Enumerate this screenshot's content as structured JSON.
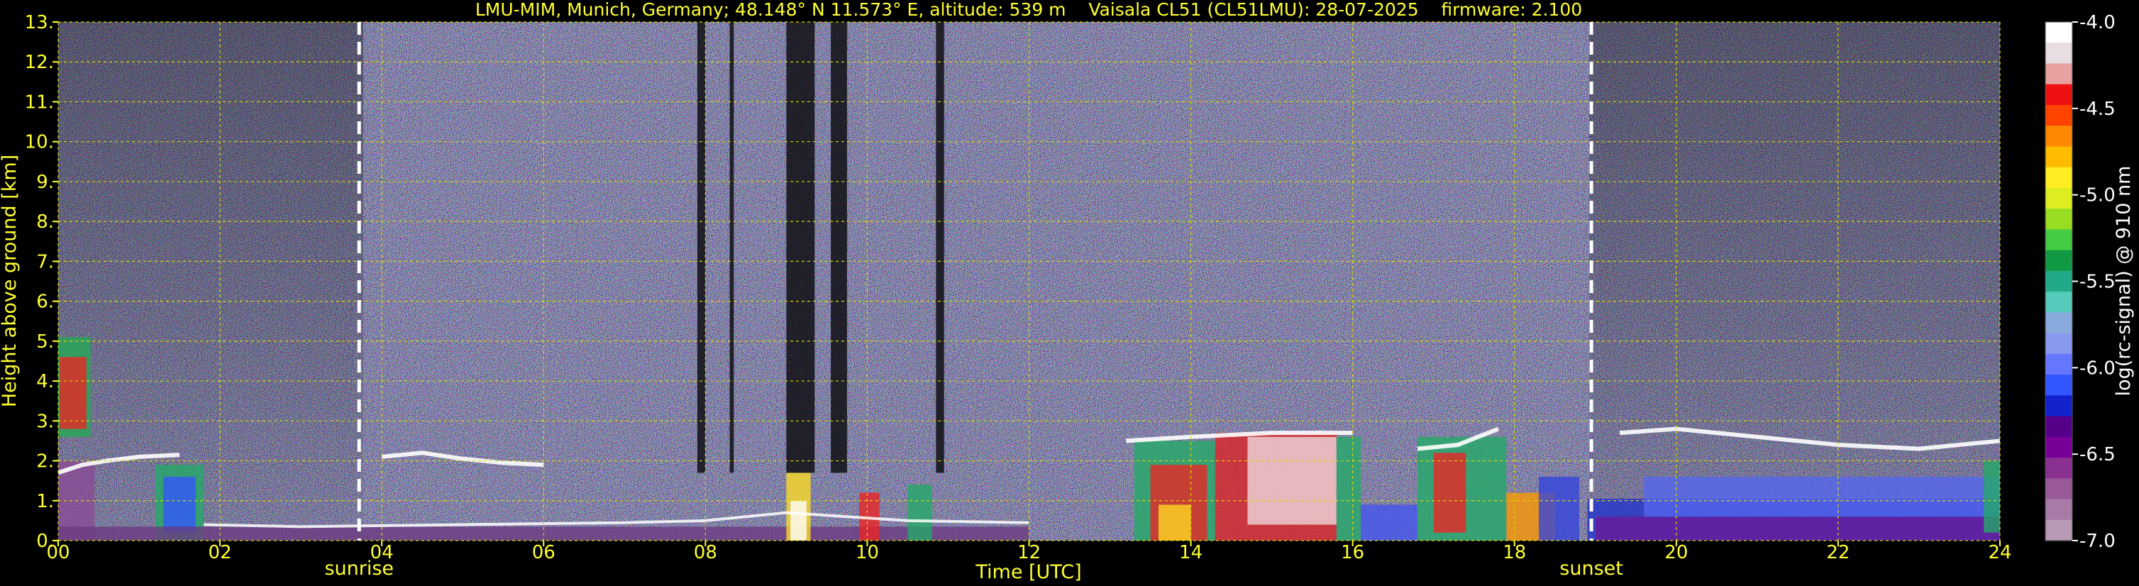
{
  "chart_data": {
    "type": "heatmap",
    "title": "LMU-MIM, Munich, Germany; 48.148° N 11.573° E, altitude: 539 m    Vaisala CL51 (CL51LMU): 28-07-2025    firmware: 2.100",
    "xlabel": "Time [UTC]",
    "ylabel": "Height above ground [km]",
    "xlim": [
      0,
      24
    ],
    "ylim": [
      0,
      13
    ],
    "x_ticks": [
      "00",
      "02",
      "04",
      "06",
      "08",
      "10",
      "12",
      "14",
      "16",
      "18",
      "20",
      "22",
      "24"
    ],
    "y_ticks": [
      "0.",
      "1.",
      "2.",
      "3.",
      "4.",
      "5.",
      "6.",
      "7.",
      "8.",
      "9.",
      "10.",
      "11.",
      "12.",
      "13."
    ],
    "grid": true,
    "colorbar": {
      "label": "log(rc-signal) @ 910 nm",
      "range": [
        -7.0,
        -4.0
      ],
      "ticks": [
        "-4.0",
        "-4.5",
        "-5.0",
        "-5.5",
        "-6.0",
        "-6.5",
        "-7.0"
      ],
      "colors": [
        "#ffffff",
        "#e8dde0",
        "#e8a0a0",
        "#ee1111",
        "#ff4400",
        "#ff8800",
        "#ffbb00",
        "#ffee22",
        "#ddee22",
        "#99dd22",
        "#44cc44",
        "#119944",
        "#22aa88",
        "#55ccbb",
        "#88aadd",
        "#8899ee",
        "#6677ff",
        "#3355ff",
        "#1122cc",
        "#550088",
        "#770099",
        "#8a3090",
        "#9a5a9a",
        "#a87aa6",
        "#b89ab5"
      ]
    },
    "annotations": [
      {
        "label": "sunrise",
        "x": 3.72
      },
      {
        "label": "sunset",
        "x": 18.95
      }
    ],
    "cloud_base_layers": [
      {
        "x": [
          0.0,
          0.3,
          0.6,
          1.0,
          1.5
        ],
        "y": [
          1.7,
          1.9,
          2.0,
          2.1,
          2.15
        ]
      },
      {
        "x": [
          4.0,
          4.5,
          5.0,
          5.5,
          6.0
        ],
        "y": [
          2.1,
          2.2,
          2.05,
          1.95,
          1.9
        ]
      },
      {
        "x": [
          13.2,
          14.0,
          15.0,
          16.0
        ],
        "y": [
          2.5,
          2.6,
          2.7,
          2.7
        ]
      },
      {
        "x": [
          16.8,
          17.3,
          17.8
        ],
        "y": [
          2.3,
          2.4,
          2.8
        ]
      },
      {
        "x": [
          19.3,
          20.0,
          21.0,
          22.0,
          23.0,
          24.0
        ],
        "y": [
          2.7,
          2.8,
          2.6,
          2.4,
          2.3,
          2.5
        ]
      }
    ],
    "boundary_layer": {
      "x": [
        1.8,
        3.0,
        5.0,
        7.0,
        8.0,
        9.0,
        10.5,
        12.0
      ],
      "y": [
        0.4,
        0.35,
        0.4,
        0.45,
        0.5,
        0.7,
        0.5,
        0.45
      ]
    }
  }
}
